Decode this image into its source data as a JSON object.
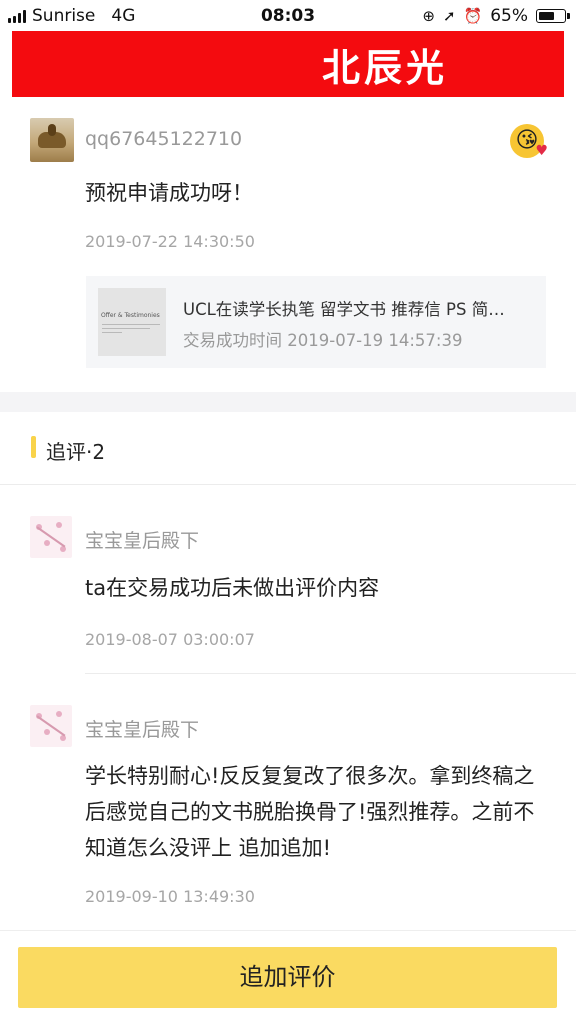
{
  "status_bar": {
    "carrier": "Sunrise",
    "network": "4G",
    "time": "08:03",
    "battery": "65%",
    "battery_level": 0.65,
    "icons": [
      "signal-icon",
      "lock-rotation-icon",
      "location-arrow-icon",
      "alarm-icon",
      "battery-icon"
    ]
  },
  "banner": {
    "title": "北辰光",
    "color": "#f40b0f"
  },
  "review": {
    "username": "qq67645122710",
    "text": "预祝申请成功呀！",
    "date": "2019-07-22 14:30:50",
    "emoji": "kiss-heart-emoji",
    "order": {
      "title": "UCL在读学长执笔 留学文书 推荐信 PS 简…",
      "time": "交易成功时间 2019-07-19 14:57:39",
      "thumb_title": "Offer & Testimonies"
    }
  },
  "followups": {
    "title": "追评·2",
    "accent": "#f9d34a",
    "items": [
      {
        "username": "宝宝皇后殿下",
        "text": "ta在交易成功后未做出评价内容",
        "date": "2019-08-07 03:00:07"
      },
      {
        "username": "宝宝皇后殿下",
        "text": "学长特别耐心!反反复复改了很多次。拿到终稿之后感觉自己的文书脱胎换骨了!强烈推荐。之前不知道怎么没评上 追加追加!",
        "date": "2019-09-10 13:49:30"
      }
    ]
  },
  "bottom": {
    "button_label": "追加评价",
    "button_color": "#fada61"
  }
}
